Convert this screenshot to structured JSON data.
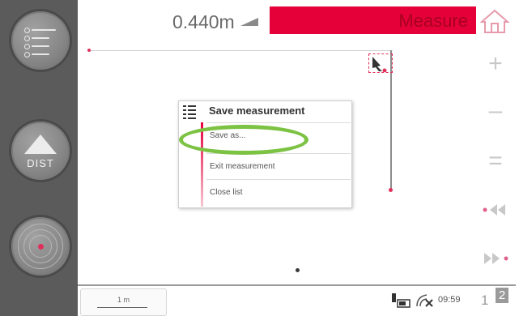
{
  "header": {
    "distance": "0.440m",
    "title": "Measure"
  },
  "left_panel": {
    "dist_label": "DIST"
  },
  "popup": {
    "title": "Save measurement",
    "items": [
      {
        "label": "Save as..."
      },
      {
        "label": "Exit measurement"
      },
      {
        "label": "Close list"
      }
    ]
  },
  "status": {
    "scale": "1 m",
    "time": "09:59",
    "page_current": "1",
    "page_other": "2"
  },
  "icons": {
    "menu": "list-menu-icon",
    "dist": "dist-triangle-icon",
    "target": "target-icon",
    "home": "home-icon",
    "plus": "plus-icon",
    "minus": "minus-icon",
    "equals": "equals-icon",
    "rewind": "rewind-icon",
    "fast_forward": "fast-forward-icon",
    "slope": "slope-icon",
    "battery": "battery-icon",
    "signal": "signal-icon"
  },
  "colors": {
    "accent": "#e5003a",
    "highlight": "#7cc243",
    "panel": "#5b5b5b"
  }
}
